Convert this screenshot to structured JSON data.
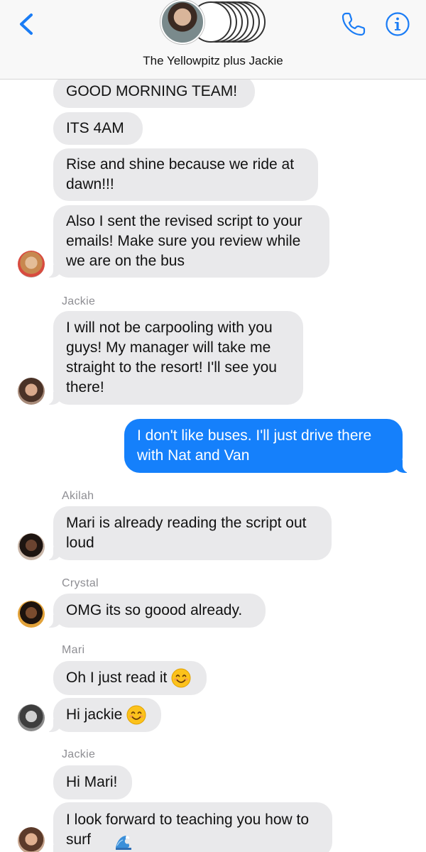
{
  "header": {
    "title": "The Yellowpitz plus Jackie",
    "back_icon": "chevron-left-icon",
    "call_icon": "phone-icon",
    "info_icon": "info-icon",
    "accent": "#1a7cf5"
  },
  "messages": [
    {
      "text": "GOOD MORNING TEAM!"
    },
    {
      "text": "ITS 4AM"
    },
    {
      "text": "Rise and shine because we ride at\ndawn!!!"
    },
    {
      "text": "Also I sent the revised script to your\nemails! Make sure you review while\nwe are on the bus"
    },
    {
      "sender": "Jackie",
      "text": "I will not be carpooling with you\nguys! My manager will take me\nstraight to the resort! I'll see you\nthere!"
    },
    {
      "text": "I don't like buses. I'll just drive there\nwith Nat and Van"
    },
    {
      "sender": "Akilah",
      "text": "Mari is already reading the script out\nloud"
    },
    {
      "sender": "Crystal",
      "text": "OMG its so goood already."
    },
    {
      "sender": "Mari",
      "text": "Oh I just read it",
      "emoji": "smiling-face-emoji"
    },
    {
      "text": "Hi jackie",
      "emoji": "smiling-face-emoji"
    },
    {
      "sender": "Jackie",
      "text": "Hi Mari!"
    },
    {
      "text": "I look forward to teaching you how to\nsurf",
      "emoji": "water-wave-emoji"
    }
  ],
  "colors": {
    "incoming_bubble": "#e9e9eb",
    "outgoing_bubble": "#1580fb",
    "sender_label": "#8e8e93"
  }
}
